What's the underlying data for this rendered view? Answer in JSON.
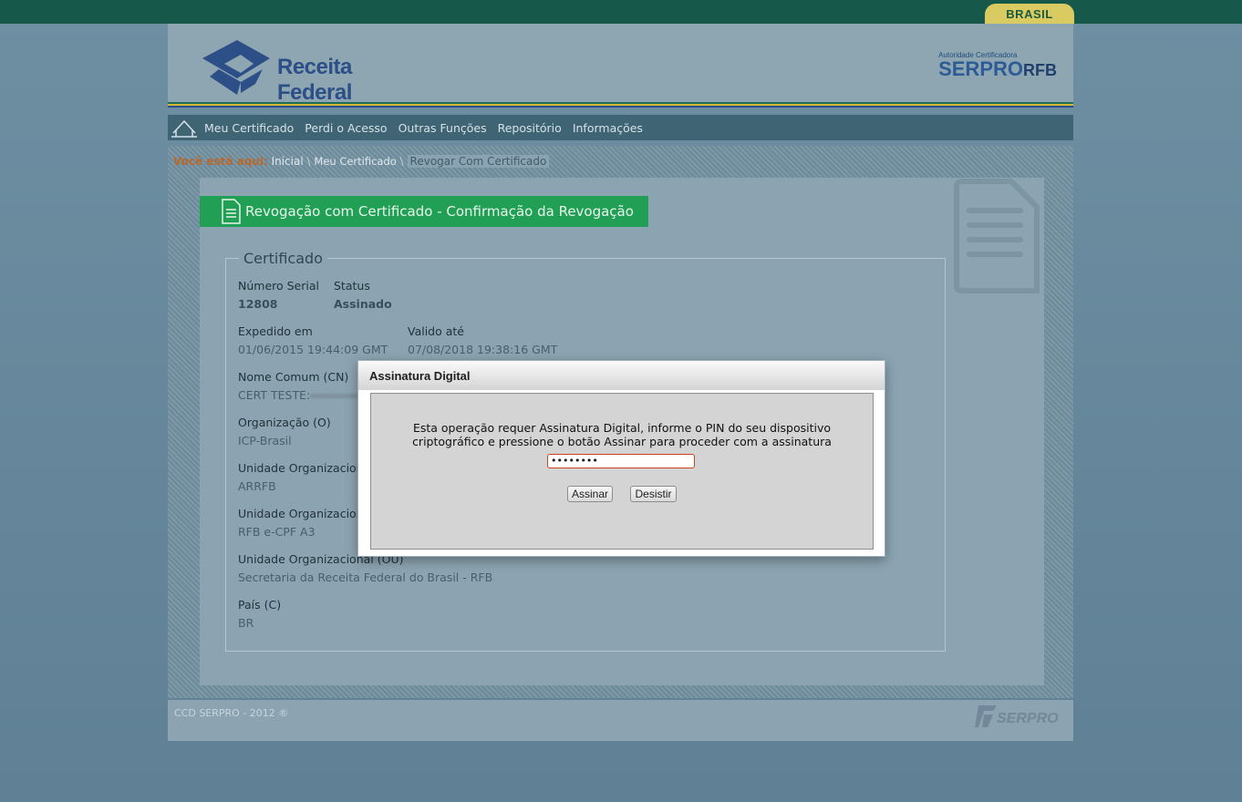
{
  "brand": {
    "brasil": "BRASIL",
    "logo_text": "Receita Federal",
    "ca_small": "Autoridade Certificadora",
    "ca_big": "SERPRO",
    "ca_big_suffix": "RFB"
  },
  "nav": {
    "items": [
      "Meu Certificado",
      "Perdi o Acesso",
      "Outras Funções",
      "Repositório",
      "Informações"
    ]
  },
  "breadcrumb": {
    "label": "Você está aqui:",
    "items": [
      "Inicial",
      "Meu Certificado",
      "Revogar Com Certificado"
    ],
    "separator": "\\"
  },
  "page": {
    "title": "Revogação com Certificado - Confirmação da Revogação"
  },
  "certificate": {
    "legend": "Certificado",
    "serial_label": "Número Serial",
    "serial_value": "12808",
    "status_label": "Status",
    "status_value": "Assinado",
    "issued_label": "Expedido em",
    "issued_value": "01/06/2015 19:44:09 GMT",
    "valid_label": "Valido até",
    "valid_value": "07/08/2018 19:38:16 GMT",
    "cn_label": "Nome Comum (CN)",
    "cn_value": "CERT TESTE:",
    "o_label": "Organização (O)",
    "o_value": "ICP-Brasil",
    "ou1_label": "Unidade Organizacional (OU)",
    "ou1_value": "ARRFB",
    "ou2_label": "Unidade Organizacional (OU)",
    "ou2_value": "RFB e-CPF A3",
    "ou3_label": "Unidade Organizacional (OU)",
    "ou3_value": "Secretaria da Receita Federal do Brasil - RFB",
    "c_label": "País (C)",
    "c_value": "BR"
  },
  "footer": {
    "copyright": "CCD SERPRO - 2012 ®",
    "logo": "SERPRO"
  },
  "dialog": {
    "title": "Assinatura Digital",
    "message_line1": "Esta operação requer Assinatura Digital, informe o PIN do seu dispositivo",
    "message_line2": "criptográfico e pressione o botão Assinar para proceder com a assinatura",
    "pin_value": "••••••••",
    "sign_label": "Assinar",
    "cancel_label": "Desistir"
  },
  "colors": {
    "topbar": "#16584a",
    "title_green": "#21a055",
    "breadcrumb_label": "#b9672b",
    "pin_border": "#c9441b"
  }
}
